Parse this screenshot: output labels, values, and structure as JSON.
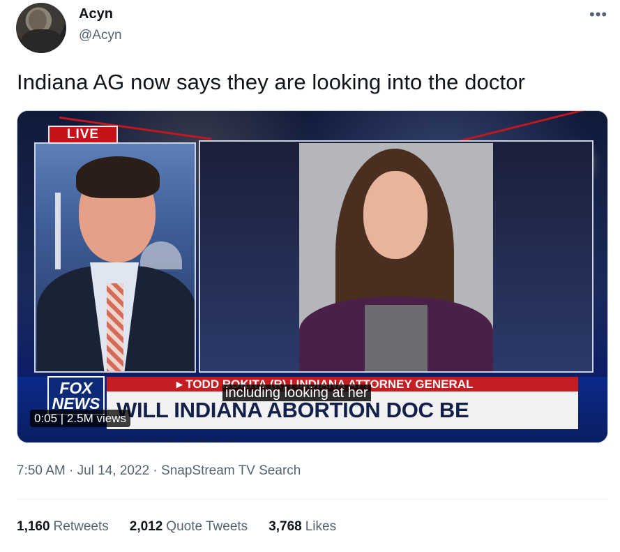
{
  "author": {
    "name": "Acyn",
    "handle": "@Acyn"
  },
  "more_label": "•••",
  "tweet_text": "Indiana AG now says they are looking into the doctor",
  "video": {
    "live_badge": "LIVE",
    "network_logo": "FOX NEWS",
    "name_strip": "▸ TODD ROKITA (R) | INDIANA ATTORNEY GENERAL",
    "headline": "WILL INDIANA ABORTION DOC BE CHARGED?",
    "caption": "including looking at her",
    "timecode": "0:05 | 2.5M views"
  },
  "meta": {
    "time": "7:50 AM",
    "date": "Jul 14, 2022",
    "separator": " · ",
    "source": "SnapStream TV Search"
  },
  "stats": [
    {
      "count": "1,160",
      "label": "Retweets"
    },
    {
      "count": "2,012",
      "label": "Quote Tweets"
    },
    {
      "count": "3,768",
      "label": "Likes"
    }
  ]
}
